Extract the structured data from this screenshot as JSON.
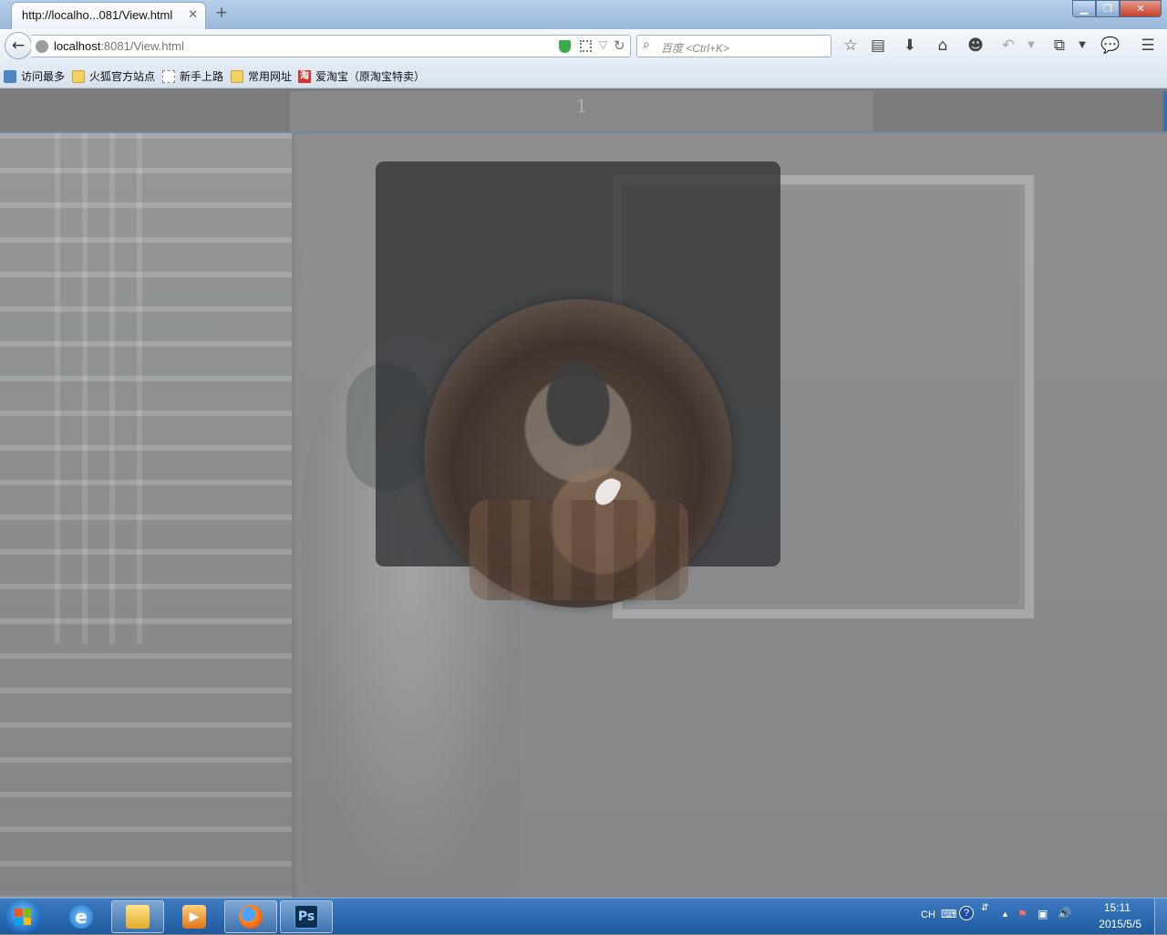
{
  "browser": {
    "tab_title": "http://localho...081/View.html",
    "tab_close": "✕",
    "new_tab": "+",
    "url_host": "localhost",
    "url_rest": ":8081/View.html",
    "search_placeholder": "百度 <Ctrl+K>"
  },
  "bookmarks": [
    {
      "label": "访问最多",
      "icon": "blue-bookmark-icon"
    },
    {
      "label": "火狐官方站点",
      "icon": "folder-icon"
    },
    {
      "label": "新手上路",
      "icon": "dotted-page-icon"
    },
    {
      "label": "常用网址",
      "icon": "folder-icon"
    },
    {
      "label": "爱淘宝（原淘宝特卖）",
      "icon": "taobao-icon"
    }
  ],
  "taobao_glyph": "淘",
  "page": {
    "page_number": "1"
  },
  "taskbar": {
    "apps": [
      "internet-explorer",
      "file-explorer",
      "media-player",
      "firefox",
      "photoshop"
    ],
    "photoshop_label": "Ps",
    "ime": "CH",
    "help": "?",
    "time": "15:11",
    "date": "2015/5/5"
  }
}
